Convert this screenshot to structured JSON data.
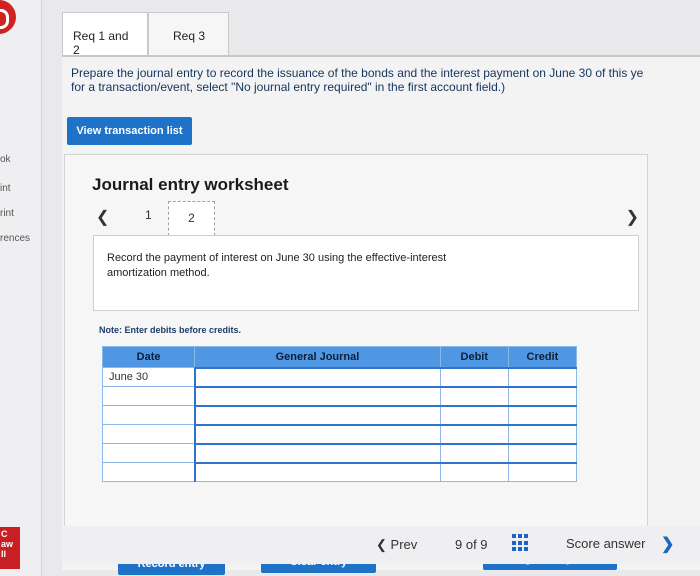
{
  "left_nav": {
    "items": [
      "ok",
      "int",
      "rint",
      "rences"
    ],
    "badge_lines": [
      "C",
      "aw",
      "ll"
    ]
  },
  "tabs": [
    {
      "label": "Req 1 and 2"
    },
    {
      "label": "Req 3"
    }
  ],
  "instructions": {
    "line1": "Prepare the journal entry to record the issuance of the bonds and the interest payment on June 30 of this ye",
    "line2": "for a transaction/event, select \"No journal entry required\" in the first account field.)"
  },
  "view_transaction_list": "View transaction list",
  "worksheet": {
    "title": "Journal entry worksheet",
    "pages": [
      "1",
      "2"
    ],
    "description": "Record the payment of interest on June 30 using the effective-interest amortization method.",
    "note": "Note: Enter debits before credits.",
    "columns": [
      "Date",
      "General Journal",
      "Debit",
      "Credit"
    ],
    "rows": [
      {
        "date": "June 30",
        "account": "",
        "debit": "",
        "credit": ""
      },
      {
        "date": "",
        "account": "",
        "debit": "",
        "credit": ""
      },
      {
        "date": "",
        "account": "",
        "debit": "",
        "credit": ""
      },
      {
        "date": "",
        "account": "",
        "debit": "",
        "credit": ""
      },
      {
        "date": "",
        "account": "",
        "debit": "",
        "credit": ""
      },
      {
        "date": "",
        "account": "",
        "debit": "",
        "credit": ""
      }
    ]
  },
  "buttons": {
    "record": "Record entry",
    "clear": "Clear entry",
    "view_general": "View general journal"
  },
  "footer": {
    "prev": "Prev",
    "count": "9  of  9",
    "score": "Score answer"
  },
  "colors": {
    "primary_button": "#1e72c8",
    "table_header": "#4f97e3",
    "logo_red": "#cf2222"
  }
}
